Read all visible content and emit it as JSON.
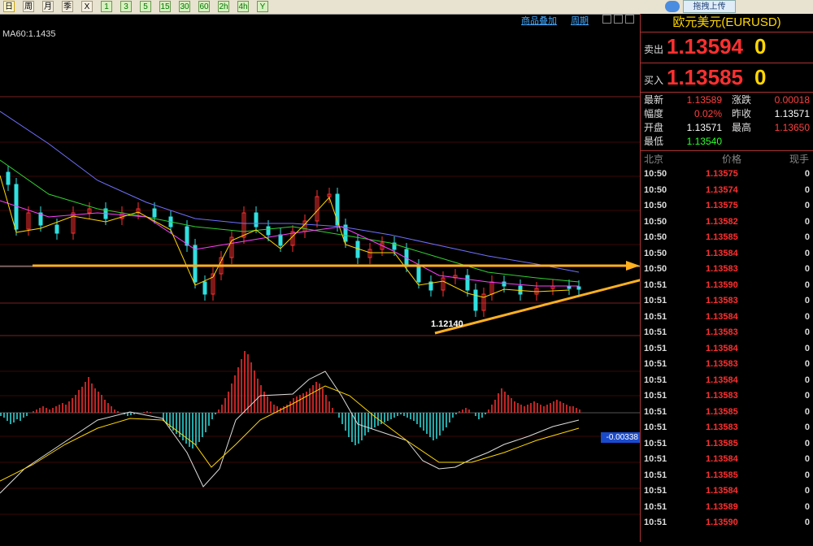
{
  "toolbar": {
    "buttons": [
      {
        "label": "日",
        "kind": "period",
        "active": true
      },
      {
        "label": "周",
        "kind": "period"
      },
      {
        "label": "月",
        "kind": "period"
      },
      {
        "label": "季",
        "kind": "period"
      },
      {
        "label": "X",
        "kind": "period"
      },
      {
        "label": "1",
        "kind": "minute"
      },
      {
        "label": "3",
        "kind": "minute"
      },
      {
        "label": "5",
        "kind": "minute"
      },
      {
        "label": "15",
        "kind": "minute"
      },
      {
        "label": "30",
        "kind": "minute"
      },
      {
        "label": "60",
        "kind": "minute"
      },
      {
        "label": "2h",
        "kind": "minute"
      },
      {
        "label": "4h",
        "kind": "minute"
      },
      {
        "label": "Y",
        "kind": "minute"
      }
    ],
    "upload_label": "拖拽上传"
  },
  "chart_header": {
    "overlay_link": "商品叠加",
    "period_link": "周期",
    "ma_label": "MA60:1.1435"
  },
  "chart": {
    "low_annotation": "1.12140",
    "macd_value_label": "-0.00338",
    "colors": {
      "up": "#ff3030",
      "down": "#30e0e0",
      "ma5": "#ffffff",
      "ma10": "#ffd700",
      "ma20": "#ff40ff",
      "ma30": "#30d030",
      "ma60": "#7070ff",
      "trendline": "#ffb020"
    }
  },
  "quote_panel": {
    "title": "欧元美元(EURUSD)",
    "sell_label": "卖出",
    "sell_price": "1.13594",
    "sell_tail": "0",
    "buy_label": "买入",
    "buy_price": "1.13585",
    "buy_tail": "0",
    "stats": [
      {
        "k1": "最新",
        "v1": "1.13589",
        "c1": "#ff4040",
        "k2": "涨跌",
        "v2": "0.00018",
        "c2": "#ff4040"
      },
      {
        "k1": "幅度",
        "v1": "0.02%",
        "c1": "#ff4040",
        "k2": "昨收",
        "v2": "1.13571",
        "c2": "#ffffff"
      },
      {
        "k1": "开盘",
        "v1": "1.13571",
        "c1": "#ffffff",
        "k2": "最高",
        "v2": "1.13650",
        "c2": "#ff4040"
      },
      {
        "k1": "最低",
        "v1": "1.13540",
        "c1": "#30ff30",
        "k2": "",
        "v2": "",
        "c2": "#ffffff"
      }
    ],
    "ticks_header": {
      "time": "北京",
      "price": "价格",
      "vol": "现手"
    },
    "ticks": [
      {
        "time": "10:50",
        "price": "1.13575",
        "vol": "0"
      },
      {
        "time": "10:50",
        "price": "1.13574",
        "vol": "0"
      },
      {
        "time": "10:50",
        "price": "1.13575",
        "vol": "0"
      },
      {
        "time": "10:50",
        "price": "1.13582",
        "vol": "0"
      },
      {
        "time": "10:50",
        "price": "1.13585",
        "vol": "0"
      },
      {
        "time": "10:50",
        "price": "1.13584",
        "vol": "0"
      },
      {
        "time": "10:50",
        "price": "1.13583",
        "vol": "0"
      },
      {
        "time": "10:51",
        "price": "1.13590",
        "vol": "0"
      },
      {
        "time": "10:51",
        "price": "1.13583",
        "vol": "0"
      },
      {
        "time": "10:51",
        "price": "1.13584",
        "vol": "0"
      },
      {
        "time": "10:51",
        "price": "1.13583",
        "vol": "0"
      },
      {
        "time": "10:51",
        "price": "1.13584",
        "vol": "0"
      },
      {
        "time": "10:51",
        "price": "1.13583",
        "vol": "0"
      },
      {
        "time": "10:51",
        "price": "1.13584",
        "vol": "0"
      },
      {
        "time": "10:51",
        "price": "1.13583",
        "vol": "0"
      },
      {
        "time": "10:51",
        "price": "1.13585",
        "vol": "0"
      },
      {
        "time": "10:51",
        "price": "1.13583",
        "vol": "0"
      },
      {
        "time": "10:51",
        "price": "1.13585",
        "vol": "0"
      },
      {
        "time": "10:51",
        "price": "1.13584",
        "vol": "0"
      },
      {
        "time": "10:51",
        "price": "1.13585",
        "vol": "0"
      },
      {
        "time": "10:51",
        "price": "1.13584",
        "vol": "0"
      },
      {
        "time": "10:51",
        "price": "1.13589",
        "vol": "0"
      },
      {
        "time": "10:51",
        "price": "1.13590",
        "vol": "0"
      }
    ]
  }
}
